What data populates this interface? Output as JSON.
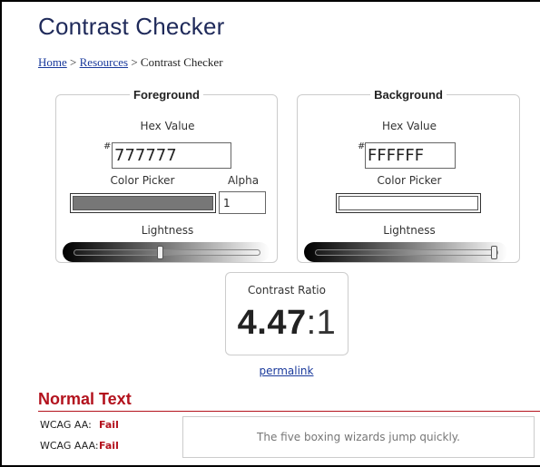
{
  "page": {
    "title": "Contrast Checker"
  },
  "breadcrumb": {
    "home": "Home",
    "separator1": " > ",
    "resources": "Resources",
    "separator2": " > ",
    "current": "Contrast Checker"
  },
  "foreground": {
    "legend": "Foreground",
    "hex_label": "Hex Value",
    "hash": "#",
    "hex_value": "777777",
    "color_picker_label": "Color Picker",
    "alpha_label": "Alpha",
    "alpha_value": "1",
    "lightness_label": "Lightness",
    "swatch_color": "#777777",
    "lightness_level": 0.47
  },
  "background": {
    "legend": "Background",
    "hex_label": "Hex Value",
    "hash": "#",
    "hex_value": "FFFFFF",
    "color_picker_label": "Color Picker",
    "lightness_label": "Lightness",
    "swatch_color": "#ffffff",
    "lightness_level": 1.0
  },
  "contrast": {
    "label": "Contrast Ratio",
    "ratio": "4.47",
    "suffix": ":1"
  },
  "permalink": "permalink",
  "normal_text": {
    "title": "Normal Text",
    "aa_label": "WCAG AA:",
    "aa_result": "Fail",
    "aaa_label": "WCAG AAA:",
    "aaa_result": "Fail",
    "sample": "The five boxing wizards jump quickly."
  },
  "colors": {
    "heading": "#1f2a5a",
    "link": "#1a3a9c",
    "fail": "#b3121d"
  }
}
